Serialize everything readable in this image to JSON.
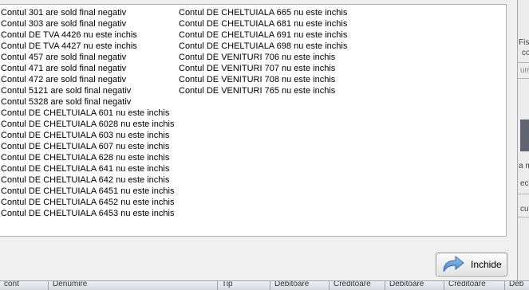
{
  "messages": {
    "column1": [
      "Contul 301 are sold final negativ",
      "Contul 303 are sold final negativ",
      "Contul DE TVA 4426 nu este inchis",
      "Contul DE TVA 4427 nu este inchis",
      "Contul 457 are sold final negativ",
      "Contul 471 are sold final negativ",
      "Contul 472 are sold final negativ",
      "Contul 5121 are sold final negativ",
      "Contul 5328 are sold final negativ",
      "Contul DE CHELTUIALA 601 nu este inchis",
      "Contul DE CHELTUIALA 6028 nu este inchis",
      "Contul DE CHELTUIALA 603 nu este inchis",
      "Contul DE CHELTUIALA 607 nu este inchis",
      "Contul DE CHELTUIALA 628 nu este inchis",
      "Contul DE CHELTUIALA 641 nu este inchis",
      "Contul DE CHELTUIALA 642 nu este inchis",
      "Contul DE CHELTUIALA 6451 nu este inchis",
      "Contul DE CHELTUIALA 6452 nu este inchis",
      "Contul DE CHELTUIALA 6453 nu este inchis"
    ],
    "column2": [
      "Contul DE CHELTUIALA 665 nu este inchis",
      "Contul DE CHELTUIALA 681 nu este inchis",
      "Contul DE CHELTUIALA 691 nu este inchis",
      "Contul DE CHELTUIALA 698 nu este inchis",
      "Contul DE VENITURI 706 nu este inchis",
      "Contul DE VENITURI 707 nu este inchis",
      "Contul DE VENITURI 708 nu este inchis",
      "Contul DE VENITURI 765 nu este inchis"
    ]
  },
  "close_button": {
    "label": "Inchide",
    "icon": "arrow-return-icon"
  },
  "background": {
    "right_fragments": [
      "Fisc",
      "co",
      "um",
      "a m",
      "ec",
      "cu"
    ],
    "bottom_header": [
      "cont",
      "Denumire",
      "Tip",
      "Debitoare",
      "Creditoare",
      "Debitoare",
      "Creditoare",
      "Deb"
    ]
  },
  "colors": {
    "dialog_bg": "#f0f0f0",
    "message_bg": "#ffffff",
    "text": "#000000",
    "icon_blue": "#4a8ad6"
  }
}
